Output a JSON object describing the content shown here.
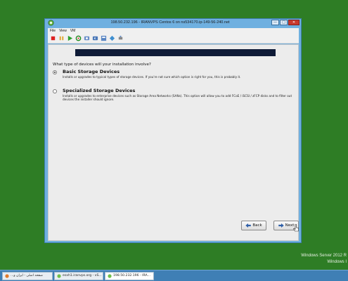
{
  "window": {
    "title": "198.50.232.196 - IRANVPS Centos 6 on ns534170.ip-149-56-240.net",
    "controls": {
      "minimize": "—",
      "maximize": "□",
      "close": "✕"
    }
  },
  "menu": {
    "items": [
      "File",
      "View",
      "VM"
    ]
  },
  "installer": {
    "question": "What type of devices will your installation involve?",
    "options": [
      {
        "title": "Basic Storage Devices",
        "description": "Installs or upgrades to typical types of storage devices.  If you're not sure which option is right for you, this is probably it.",
        "selected": true
      },
      {
        "title": "Specialized Storage Devices",
        "description": "Installs or upgrades to enterprise devices such as Storage Area Networks (SANs). This option will allow you to add FCoE / iSCSI / zFCP disks and to filter out devices the installer should ignore.",
        "selected": false
      }
    ],
    "back_label": "Back",
    "next_label": "Next"
  },
  "desktop": {
    "watermark_line1": "Windows Server 2012 R",
    "watermark_line2": "Windows I"
  },
  "taskbar": {
    "items": [
      {
        "label": "...صفحه اصلی - ایران و",
        "active": false
      },
      {
        "label": "esxh1.iranvps.org - vS...",
        "active": false
      },
      {
        "label": "198.50.232.196 - IRA...",
        "active": true
      }
    ]
  },
  "colors": {
    "desktop": "#2e7d25",
    "window_frame": "#6fb0e0",
    "banner": "#0e1a36",
    "close_button": "#c8392e"
  }
}
